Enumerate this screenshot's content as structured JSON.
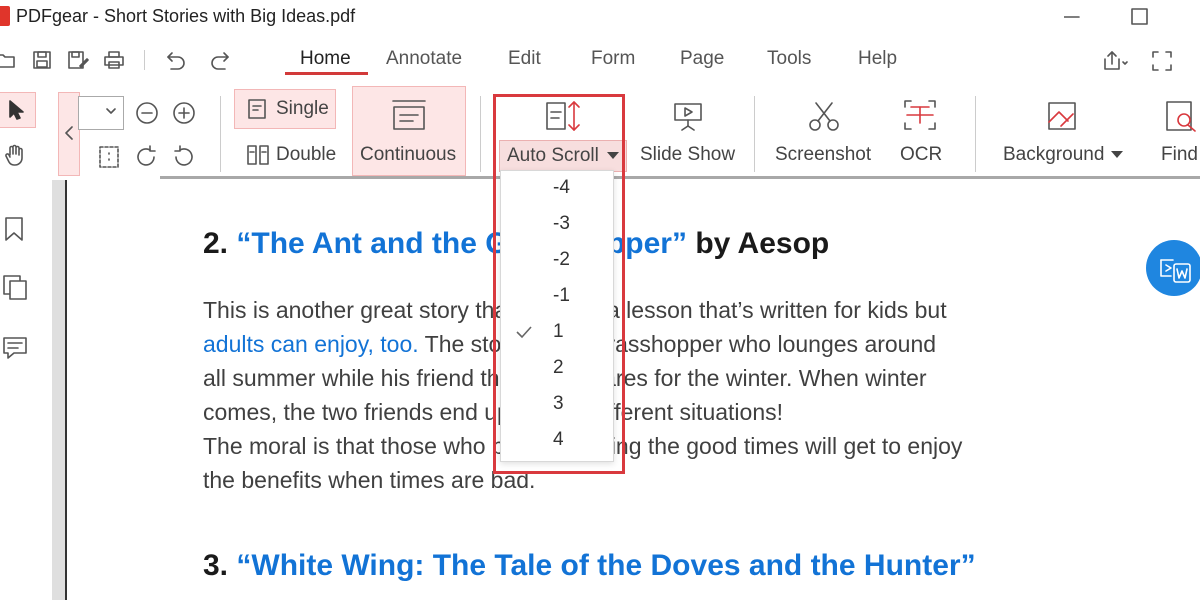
{
  "window": {
    "title": "PDFgear - Short Stories with Big Ideas.pdf"
  },
  "menu": {
    "tabs": [
      {
        "label": "Home",
        "active": true
      },
      {
        "label": "Annotate"
      },
      {
        "label": "Edit"
      },
      {
        "label": "Form"
      },
      {
        "label": "Page"
      },
      {
        "label": "Tools"
      },
      {
        "label": "Help"
      }
    ]
  },
  "ribbon": {
    "single_label": "Single",
    "double_label": "Double",
    "continuous_label": "Continuous",
    "auto_scroll_label": "Auto Scroll",
    "slide_show_label": "Slide Show",
    "screenshot_label": "Screenshot",
    "ocr_label": "OCR",
    "background_label": "Background",
    "find_label": "Find"
  },
  "auto_scroll_menu": {
    "options": [
      "-4",
      "-3",
      "-2",
      "-1",
      "1",
      "2",
      "3",
      "4"
    ],
    "selected": "1"
  },
  "document": {
    "heading2": {
      "number": "2.",
      "title": "“The Ant and the Grasshopper”",
      "by": "by Aesop"
    },
    "para_lines": [
      "This is another great story that teaches a lesson that’s written for kids but",
      "adults can enjoy, too.",
      " The story is of a grasshopper who lounges around",
      "all summer while his friend the ant prepares for the winter. When winter",
      "comes, the two friends end up in very different situations!",
      "The moral is that those who prepare during the good times will get to enjoy",
      "the benefits when times are bad."
    ],
    "heading3": {
      "number": "3.",
      "title": "“White Wing: The Tale of the Doves and the Hunter”"
    }
  },
  "colors": {
    "accent_red": "#d9393e",
    "link_blue": "#1273d6",
    "convert_blue": "#1f86e0"
  }
}
